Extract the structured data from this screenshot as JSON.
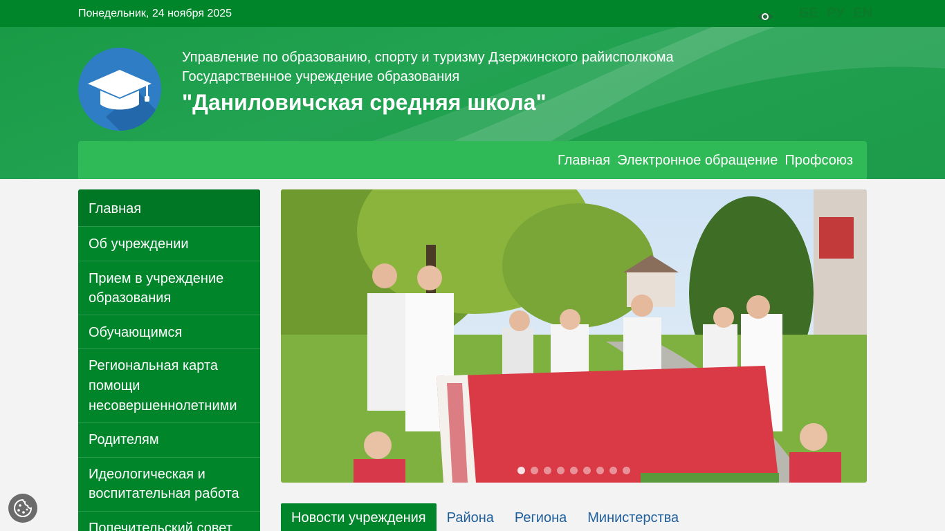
{
  "topbar": {
    "date": "Понедельник, 24 ноября 2025",
    "languages": [
      "БЕ",
      "РУ",
      "EN"
    ]
  },
  "header": {
    "line1": "Управление по образованию, спорту и туризму Дзержинского райисполкома",
    "line2": "Государственное учреждение образования",
    "title": "\"Даниловичская средняя школа\""
  },
  "nav": [
    "Главная",
    "Электронное обращение",
    "Профсоюз"
  ],
  "sidebar": [
    "Главная",
    "Об учреждении",
    "Прием в учреждение образования",
    "Обучающимся",
    "Региональная карта помощи несовершеннолетними",
    "Родителям",
    "Идеологическая и воспитательная работа",
    "Попечительский совет"
  ],
  "slider": {
    "dot_count": 9,
    "active_index": 0
  },
  "tabs": [
    "Новости учреждения",
    "Района",
    "Региона",
    "Министерства"
  ],
  "colors": {
    "primary": "#00852b",
    "nav": "#2fba57",
    "link": "#1f5f9c"
  }
}
